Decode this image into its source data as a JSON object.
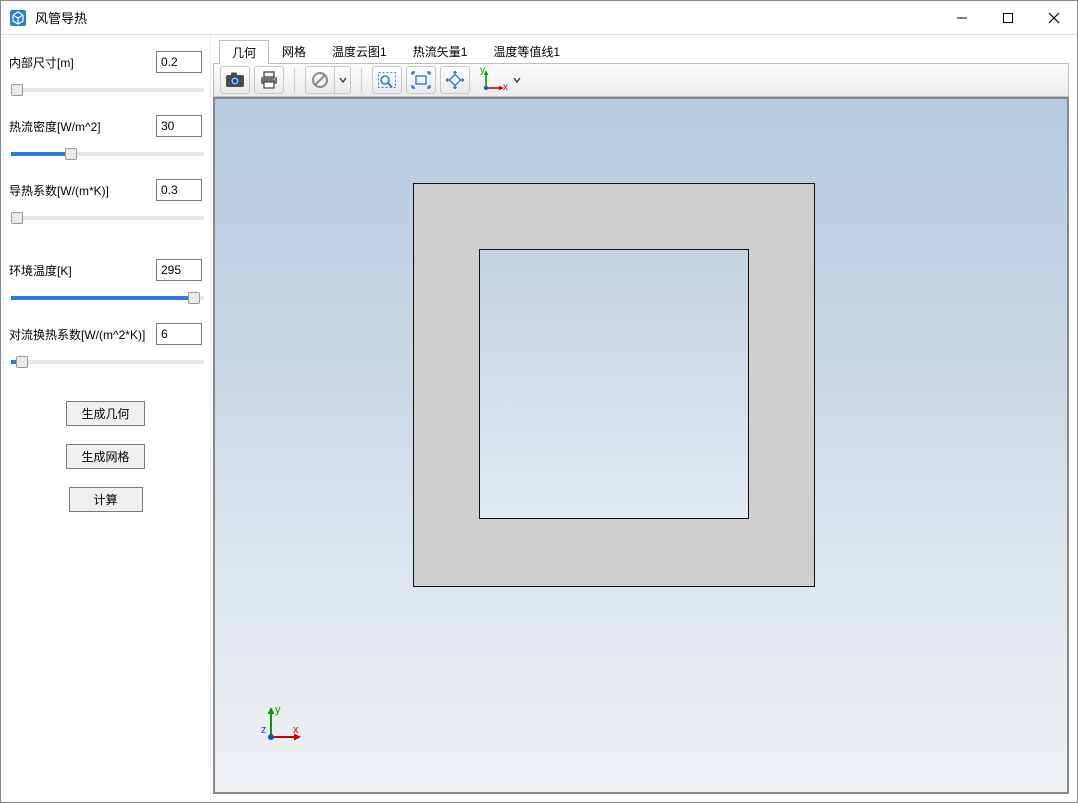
{
  "window": {
    "title": "风管导热"
  },
  "params": {
    "inner_size": {
      "label": "内部尺寸[m]",
      "value": "0.2",
      "slider_pct": 0
    },
    "heat_flux": {
      "label": "热流密度[W/m^2]",
      "value": "30",
      "slider_pct": 30
    },
    "conductivity": {
      "label": "导热系数[W/(m*K)]",
      "value": "0.3",
      "slider_pct": 0
    },
    "ambient_temp": {
      "label": "环境温度[K]",
      "value": "295",
      "slider_pct": 98
    },
    "convection_coef": {
      "label": "对流换热系数[W/(m^2*K)]",
      "value": "6",
      "slider_pct": 3
    }
  },
  "buttons": {
    "gen_geometry": "生成几何",
    "gen_mesh": "生成网格",
    "compute": "计算"
  },
  "tabs": [
    {
      "id": "geom",
      "label": "几何",
      "active": true
    },
    {
      "id": "mesh",
      "label": "网格",
      "active": false
    },
    {
      "id": "temp_cloud1",
      "label": "温度云图1",
      "active": false
    },
    {
      "id": "hflux_vec1",
      "label": "热流矢量1",
      "active": false
    },
    {
      "id": "temp_iso1",
      "label": "温度等值线1",
      "active": false
    }
  ],
  "toolbar": {
    "axes": {
      "y": "y",
      "z": "z",
      "x": "x"
    }
  }
}
